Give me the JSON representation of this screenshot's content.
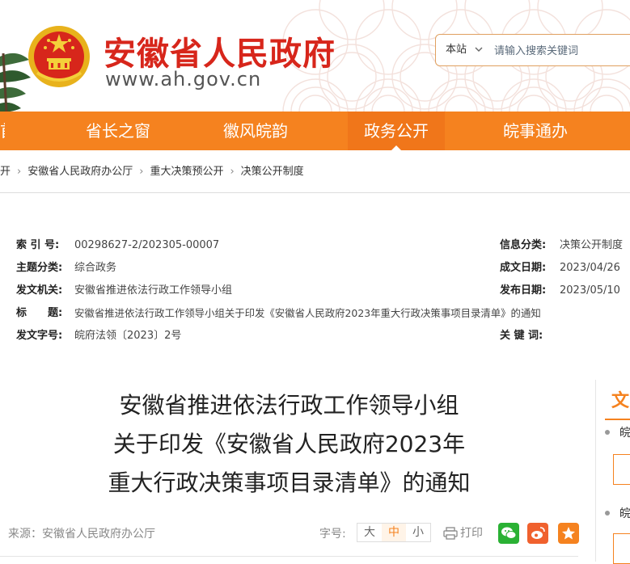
{
  "header": {
    "title": "安徽省人民政府",
    "url": "www.ah.gov.cn",
    "search": {
      "scope": "本站",
      "placeholder": "请输入搜索关键词"
    }
  },
  "nav": {
    "items": [
      {
        "label": "省长之窗"
      },
      {
        "label": "徽风皖韵"
      },
      {
        "label": "政务公开"
      },
      {
        "label": "皖事通办"
      }
    ],
    "active": "政务公开",
    "accent": "#f5821f"
  },
  "breadcrumb": {
    "items": [
      "开",
      "安徽省人民政府办公厅",
      "重大决策预公开",
      "决策公开制度"
    ]
  },
  "meta": {
    "index_label": "索 引 号:",
    "index_value": "00298627-2/202305-00007",
    "category_label": "信息分类:",
    "category_value": "决策公开制度",
    "topic_label": "主题分类:",
    "topic_value": "综合政务",
    "date_made_label": "成文日期:",
    "date_made_value": "2023/04/26",
    "issuer_label": "发文机关:",
    "issuer_value": "安徽省推进依法行政工作领导小组",
    "date_pub_label": "发布日期:",
    "date_pub_value": "2023/05/10",
    "title_label": "标　　题:",
    "title_value": "安徽省推进依法行政工作领导小组关于印发《安徽省人民政府2023年重大行政决策事项目录清单》的通知",
    "docno_label": "发文字号:",
    "docno_value": "皖府法领〔2023〕2号",
    "keywords_label": "关 键 词:",
    "keywords_value": ""
  },
  "article": {
    "title_lines": [
      "安徽省推进依法行政工作领导小组",
      "关于印发《安徽省人民政府2023年",
      "重大行政决策事项目录清单》的通知"
    ],
    "source": "来源：安徽省人民政府办公厅",
    "fontsize_label": "字号:",
    "fontsize_options": [
      "大",
      "中",
      "小"
    ],
    "fontsize_active": "中",
    "print_label": "打印"
  },
  "sidebar": {
    "head": "文",
    "item1": "皖",
    "item2": "皖"
  },
  "colors": {
    "brand_red": "#d7261b",
    "orange": "#f5821f",
    "wechat": "#2ab134",
    "weibo": "#f0612e"
  }
}
